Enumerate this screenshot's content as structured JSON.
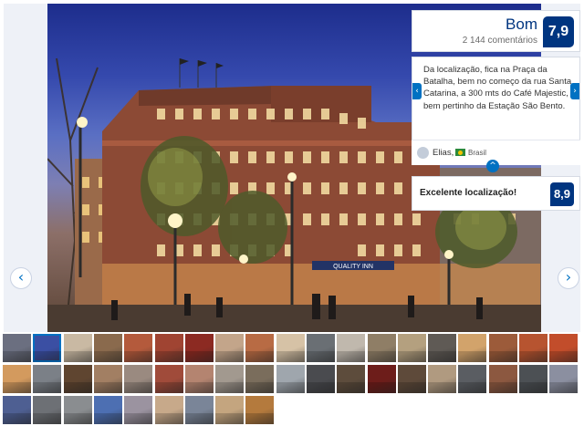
{
  "gallery": {
    "prev_label": "‹",
    "next_label": "›"
  },
  "score": {
    "word": "Bom",
    "count": "2 144 comentários",
    "value": "7,9"
  },
  "review": {
    "text": "Da localização, fica na Praça da Batalha, bem no começo da rua Santa Catarina, a 300 mts do Café Majestic, bem pertinho da Estação São Bento.",
    "author": "Elias,",
    "country": "Brasil",
    "prev_label": "‹",
    "next_label": "›",
    "collapse_label": "^"
  },
  "location": {
    "label": "Excelente localização!",
    "score": "8,9"
  },
  "hotel_sign": "QUALITY INN",
  "thumbnails": {
    "selected_index": 1,
    "colors": [
      "#6b6f80",
      "#3b4fa3",
      "#c9b9a3",
      "#8a6a4d",
      "#b45a3c",
      "#a04432",
      "#8c2a22",
      "#c3a58a",
      "#b86b44",
      "#d6c2a6",
      "#6a6f74",
      "#c0b8ad",
      "#8f7e66",
      "#b4a07f",
      "#5f5a55",
      "#d2a36b",
      "#9c5b3a",
      "#b75430",
      "#c24d2b",
      "#d39a5e",
      "#7b8087",
      "#5f4530",
      "#a27f63",
      "#9a8a80",
      "#a04b3a",
      "#b48470",
      "#a2998f",
      "#7a6d5c",
      "#9fa6ad",
      "#4a4b4f",
      "#5d4c3c",
      "#6d1d1a",
      "#5e4a3a",
      "#b09a80",
      "#5a5d62",
      "#8c5840",
      "#4c5054",
      "#8b8fa0",
      "#4e5f92",
      "#6d7075",
      "#8a8d90",
      "#4d6fb2",
      "#9b93a0",
      "#c7a98a",
      "#7a8598",
      "#c4a57f",
      "#b47a3d"
    ]
  }
}
